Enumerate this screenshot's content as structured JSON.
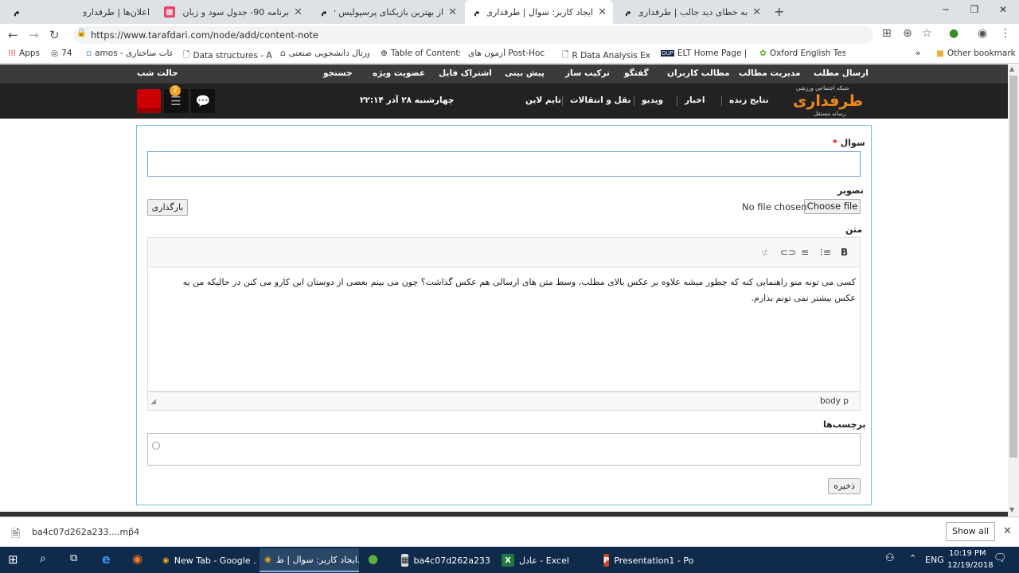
{
  "tabs": [
    {
      "title": "اعلان‌ها | طرفداری",
      "icon": "tarafdari-favicon"
    },
    {
      "title": "برنامه 90- جدول سود و زبان داوری",
      "icon": "pink-grid-favicon"
    },
    {
      "title": "از بهترین بازیکنای پرسپولیس ❤ ک",
      "icon": "tarafdari-favicon"
    },
    {
      "title": "ایجاد کاربر: سوال | طرفداری",
      "icon": "tarafdari-favicon"
    },
    {
      "title": "به خطای دید جالب | طرفداری",
      "icon": "tarafdari-favicon"
    }
  ],
  "address": {
    "url": "https://www.tarafdari.com/node/add/content-note"
  },
  "bookmarks": [
    {
      "label": "Apps"
    },
    {
      "label": "74"
    },
    {
      "label": "amos - اطلاعات ساختاری"
    },
    {
      "label": "Data structures - Adv"
    },
    {
      "label": "پورتال دانشجویی صنعتی"
    },
    {
      "label": "Table of Contents"
    },
    {
      "label": "آزمون های Post-Hoc"
    },
    {
      "label": "R Data Analysis Exam"
    },
    {
      "label": "ELT Home Page | Oxf"
    },
    {
      "label": "Oxford English Testin"
    },
    {
      "label": "»"
    },
    {
      "label": "Other bookmarks"
    }
  ],
  "site_nav_top": [
    "ارسال مطلب",
    "مدیریت مطالب",
    "مطالب کاربران",
    "گفتگو",
    "ترکیب ساز",
    "پیش بینی",
    "اشتراک فایل",
    "عضویت ویژه",
    "جستجو",
    "حالت شب"
  ],
  "site_nav_main": [
    "نتایج زنده",
    "اخبار",
    "ویدیو",
    "نقل و انتقالات",
    "تایم لاین"
  ],
  "site_date": "چهارشنبه ۲۸ آذر ۲۲:۱۴",
  "logo": {
    "name": "طرفداری",
    "tagline": "شبکه اجتماعی ورزشی",
    "sub": "رسانه مستقل"
  },
  "notification_count": "2",
  "form": {
    "question_label": "سوال",
    "required_mark": "*",
    "question_value": "",
    "image_label": "تصویر",
    "choose_file": "Choose file",
    "no_file": "No file chosen",
    "upload_button": "بارگذاری",
    "text_label": "متن",
    "body_text": "کسی می تونه منو راهنمایی کنه که چطور میشه علاوه بر عکس بالای مطلب، وسط متن های ارسالی هم عکس گذاشت؟ چون می بینم بعضی از دوستان این کارو می کنن در حالیکه من یه عکس بیشتر نمی تونم بذارم.",
    "editor_path": "body   p",
    "tags_label": "برچسب‌ها",
    "save_button": "ذخیره"
  },
  "download": {
    "filename": "ba4c07d262a233....mp4",
    "show_all": "Show all"
  },
  "taskbar": {
    "items": [
      {
        "label": "New Tab - Google ..."
      },
      {
        "label": "ایجاد کاربر: سوال | ط..."
      },
      {
        "label": "ba4c07d262a233e6..."
      },
      {
        "label": "عادل - Excel"
      },
      {
        "label": "Presentation1 - Po..."
      }
    ],
    "lang": "ENG",
    "time": "10:19 PM",
    "date": "12/19/2018"
  }
}
